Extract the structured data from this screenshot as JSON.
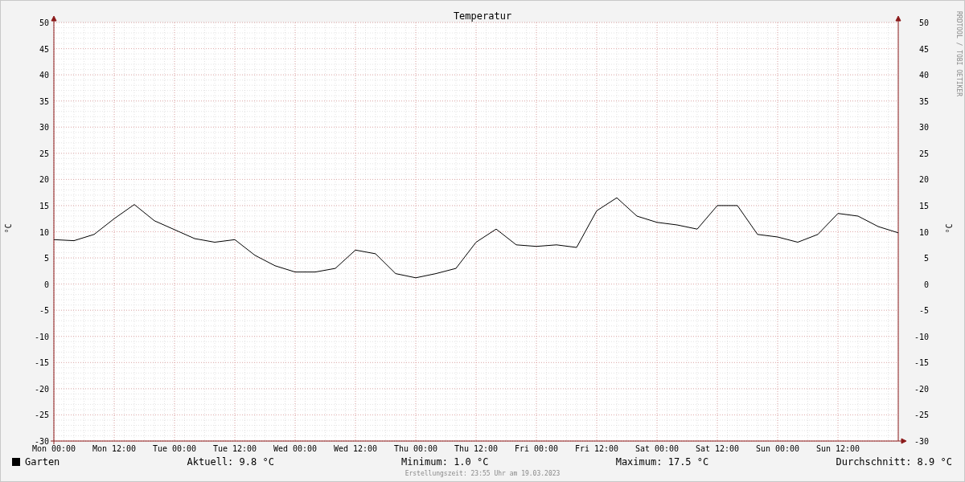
{
  "graph": {
    "watermark": "RRDTOOL / TOBI OETIKER",
    "right_ylabel": "°C",
    "right_yticks": [
      "50",
      "45",
      "40",
      "35",
      "30",
      "25",
      "20",
      "15",
      "10",
      "5",
      "0",
      "-5",
      "-10",
      "-15",
      "-20",
      "-25",
      "-30"
    ],
    "chart_data": {
      "type": "line",
      "grid": true,
      "title": "Temperatur",
      "ylabel": "°C",
      "ylim": [
        -30,
        50
      ],
      "yticks": [
        50,
        45,
        40,
        35,
        30,
        25,
        20,
        15,
        10,
        5,
        0,
        -5,
        -10,
        -15,
        -20,
        -25,
        -30
      ],
      "categories": [
        "Mon 00:00",
        null,
        null,
        "Mon 12:00",
        null,
        null,
        "Tue 00:00",
        null,
        null,
        "Tue 12:00",
        null,
        null,
        "Wed 00:00",
        null,
        null,
        "Wed 12:00",
        null,
        null,
        "Thu 00:00",
        null,
        null,
        "Thu 12:00",
        null,
        null,
        "Fri 00:00",
        null,
        null,
        "Fri 12:00",
        null,
        null,
        "Sat 00:00",
        null,
        null,
        "Sat 12:00",
        null,
        null,
        "Sun 00:00",
        null,
        null,
        "Sun 12:00",
        null,
        null,
        null
      ],
      "series": [
        {
          "name": "Garten",
          "color": "#000000",
          "values": [
            8.5,
            8.3,
            9.5,
            12.5,
            15.2,
            12.1,
            10.4,
            8.7,
            8.0,
            8.5,
            5.5,
            3.5,
            2.3,
            2.3,
            3.0,
            6.5,
            5.8,
            2.0,
            1.2,
            2.0,
            3.0,
            8.0,
            10.5,
            7.5,
            7.2,
            7.5,
            7.0,
            14.0,
            16.5,
            13.0,
            11.8,
            11.3,
            10.5,
            15.0,
            15.0,
            9.5,
            9.0,
            8.0,
            9.5,
            13.5,
            13.0,
            11.0,
            9.8
          ]
        }
      ]
    }
  },
  "legend": {
    "stats": [
      "Aktuell: 9.8 °C",
      "Minimum: 1.0 °C",
      "Maximum: 17.5 °C",
      "Durchschnitt: 8.9 °C"
    ]
  },
  "footer": "Erstellungszeit: 23:55 Uhr am 19.03.2023"
}
